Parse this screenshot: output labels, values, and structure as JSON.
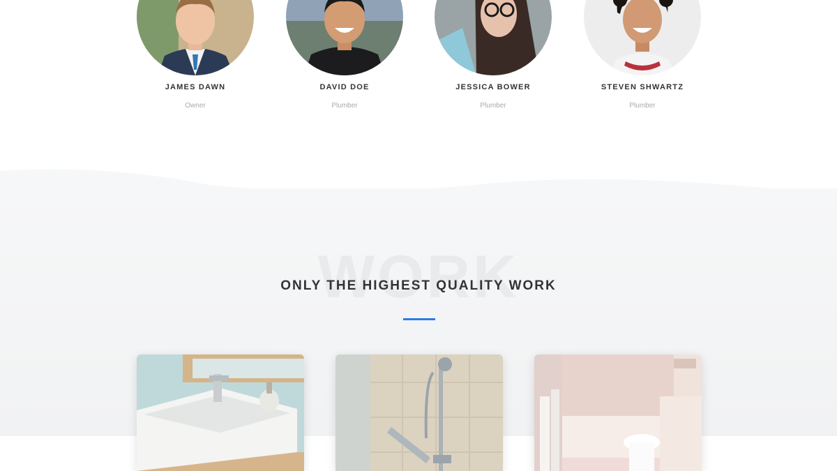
{
  "team": {
    "members": [
      {
        "name": "JAMES DAWN",
        "role": "Owner"
      },
      {
        "name": "DAVID DOE",
        "role": "Plumber"
      },
      {
        "name": "JESSICA BOWER",
        "role": "Plumber"
      },
      {
        "name": "STEVEN SHWARTZ",
        "role": "Plumber"
      }
    ]
  },
  "work": {
    "watermark": "WORK",
    "title": "ONLY THE HIGHEST QUALITY WORK",
    "accent_color": "#2d7be5",
    "items": [
      {
        "photo": "bathroom-sink"
      },
      {
        "photo": "shower-head"
      },
      {
        "photo": "bathroom-interior"
      }
    ]
  }
}
